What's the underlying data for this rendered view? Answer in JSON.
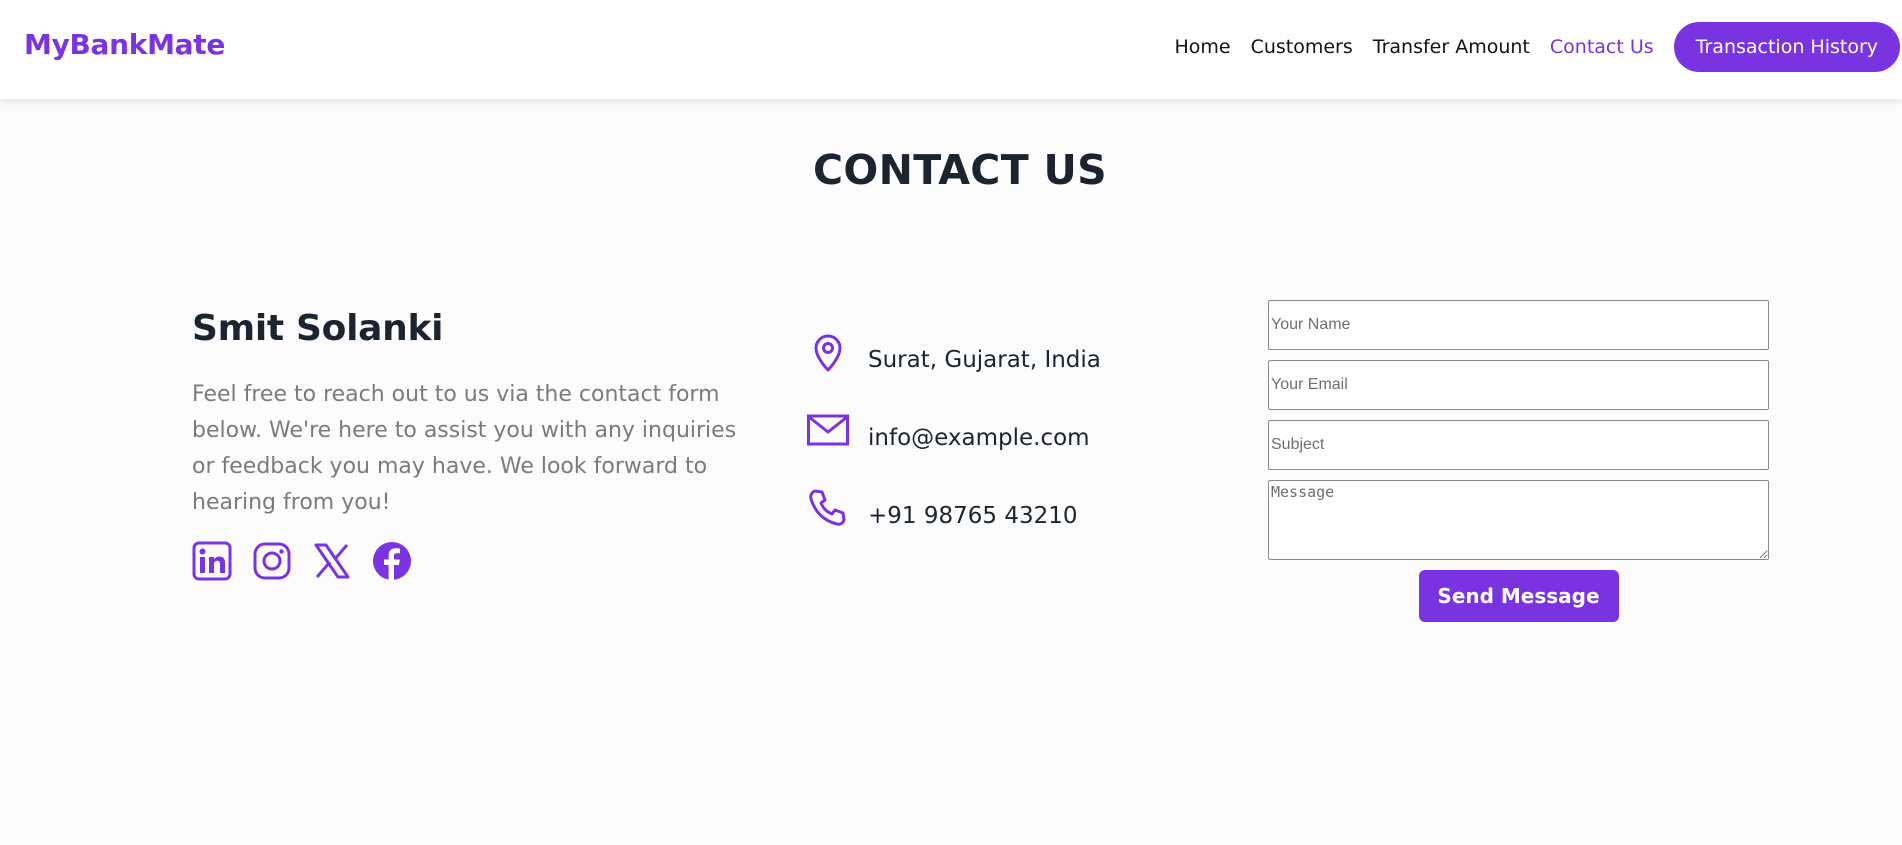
{
  "brand": {
    "name": "MyBankMate",
    "color": "#7a33e0"
  },
  "nav": {
    "items": [
      {
        "label": "Home",
        "active": false
      },
      {
        "label": "Customers",
        "active": false
      },
      {
        "label": "Transfer Amount",
        "active": false
      },
      {
        "label": "Contact Us",
        "active": true
      }
    ],
    "cta_label": "Transaction History"
  },
  "page": {
    "title": "CONTACT US"
  },
  "profile": {
    "name": "Smit Solanki",
    "about": "Feel free to reach out to us via the contact form below. We're here to assist you with any inquiries or feedback you may have. We look forward to hearing from you!",
    "socials": [
      {
        "icon": "linkedin-icon"
      },
      {
        "icon": "instagram-icon"
      },
      {
        "icon": "x-twitter-icon"
      },
      {
        "icon": "facebook-icon"
      }
    ]
  },
  "contact": {
    "location": "Surat, Gujarat, India",
    "email": "info@example.com",
    "phone": "+91 98765 43210"
  },
  "form": {
    "name_placeholder": "Your Name",
    "email_placeholder": "Your Email",
    "subject_placeholder": "Subject",
    "message_placeholder": "Message",
    "submit_label": "Send Message"
  }
}
